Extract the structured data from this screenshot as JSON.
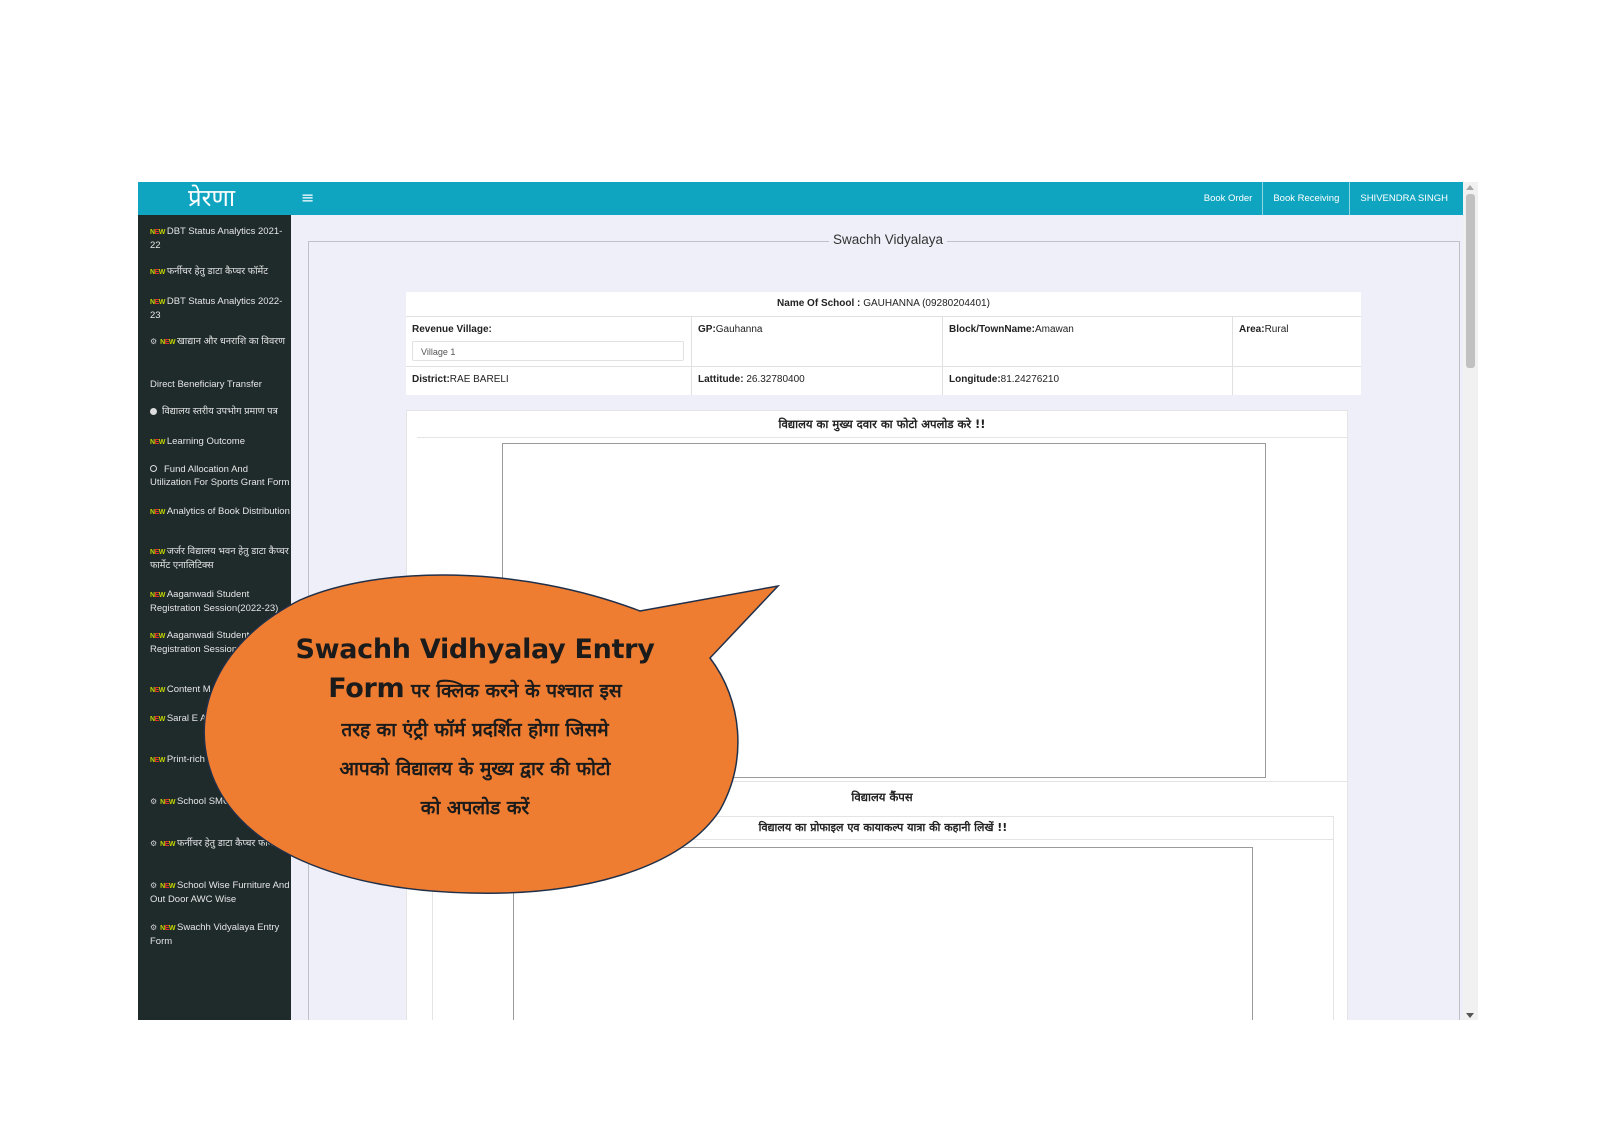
{
  "app": {
    "logo": "प्रेरणा",
    "menu_icon": "hamburger-icon",
    "topnav": [
      "Book Order",
      "Book Receiving",
      "SHIVENDRA SINGH"
    ]
  },
  "sidebar": {
    "items": [
      {
        "icons": [
          "new-badge-icon"
        ],
        "label": "DBT Status Analytics 2021-22"
      },
      {
        "icons": [
          "new-badge-icon"
        ],
        "label": "फर्नीचर हेतु डाटा कैप्चर फॉर्मेट"
      },
      {
        "icons": [
          "new-badge-icon"
        ],
        "label": "DBT Status Analytics 2022-23"
      },
      {
        "icons": [
          "dashboard-icon",
          "new-badge-icon"
        ],
        "label": "खाद्यान और धनराशि का विवरण"
      },
      {
        "icons": [],
        "label": "Direct Beneficiary Transfer"
      },
      {
        "icons": [
          "filled-circle-icon"
        ],
        "label": "विद्यालय स्तरीय उपभोग प्रमाण पत्र"
      },
      {
        "icons": [
          "new-badge-icon"
        ],
        "label": "Learning Outcome"
      },
      {
        "icons": [
          "circle-outline-icon"
        ],
        "label": "Fund Allocation And Utilization For Sports Grant Form"
      },
      {
        "icons": [
          "new-badge-icon"
        ],
        "label": "Analytics of Book Distribution"
      },
      {
        "icons": [
          "new-badge-icon"
        ],
        "label": "जर्जर विद्यालय भवन हेतु डाटा कैप्चर फार्मेट एनालिटिक्स"
      },
      {
        "icons": [
          "new-badge-icon"
        ],
        "label": "Aaganwadi Student Registration Session(2022-23)"
      },
      {
        "icons": [
          "new-badge-icon"
        ],
        "label": "Aaganwadi Student Registration Session(2 Analytics"
      },
      {
        "icons": [
          "new-badge-icon"
        ],
        "label": "Content M"
      },
      {
        "icons": [
          "new-badge-icon"
        ],
        "label": "Saral E Analytics Sess"
      },
      {
        "icons": [
          "new-badge-icon"
        ],
        "label": "Print-rich Sandarshika"
      },
      {
        "icons": [
          "dashboard-icon",
          "new-badge-icon"
        ],
        "label": "School SMC M Entry Form"
      },
      {
        "icons": [
          "dashboard-icon",
          "new-badge-icon"
        ],
        "label": "फर्नीचर हेतु डाटा कैप्चर फॉर्मेट"
      },
      {
        "icons": [
          "dashboard-icon",
          "new-badge-icon"
        ],
        "label": "School Wise Furniture And Out Door AWC Wise"
      },
      {
        "icons": [
          "dashboard-icon",
          "new-badge-icon"
        ],
        "label": "Swachh Vidyalaya Entry Form"
      }
    ],
    "new_badge": {
      "n": "N",
      "e": "E",
      "w": "W"
    }
  },
  "form": {
    "title": "Swachh Vidyalaya",
    "school_label": "Name Of School :",
    "school_value": "GAUHANNA (09280204401)",
    "revenue_village_label": "Revenue Village:",
    "revenue_village_value": "Village 1",
    "gp_label": "GP:",
    "gp_value": "Gauhanna",
    "block_label": "Block/TownName:",
    "block_value": "Amawan",
    "area_label": "Area:",
    "area_value": "Rural",
    "district_label": "District:",
    "district_value": "RAE BARELI",
    "latitude_label": "Lattitude:",
    "latitude_value": "26.32780400",
    "longitude_label": "Longitude:",
    "longitude_value": "81.24276210",
    "photo_heading": "विद्यालय का मुख्य दवार का फोटो अपलोड करे !!",
    "campus_heading": "विद्यालय कैंपस",
    "story_heading": "विद्यालय का प्रोफाइल एव कायाकल्प यात्रा की कहानी लिखें !!"
  },
  "callout": {
    "line1": "Swachh Vidhyalay Entry",
    "line2_en": "Form",
    "line2_hi": "पर क्लिक करने के पश्चात इस",
    "line3": "तरह का एंट्री फॉर्म प्रदर्शित होगा जिसमे",
    "line4": "आपको विद्यालय के मुख्य द्वार की फोटो",
    "line5": "को अपलोड करें",
    "fill": "#ee7d31",
    "stroke": "#20304a"
  }
}
